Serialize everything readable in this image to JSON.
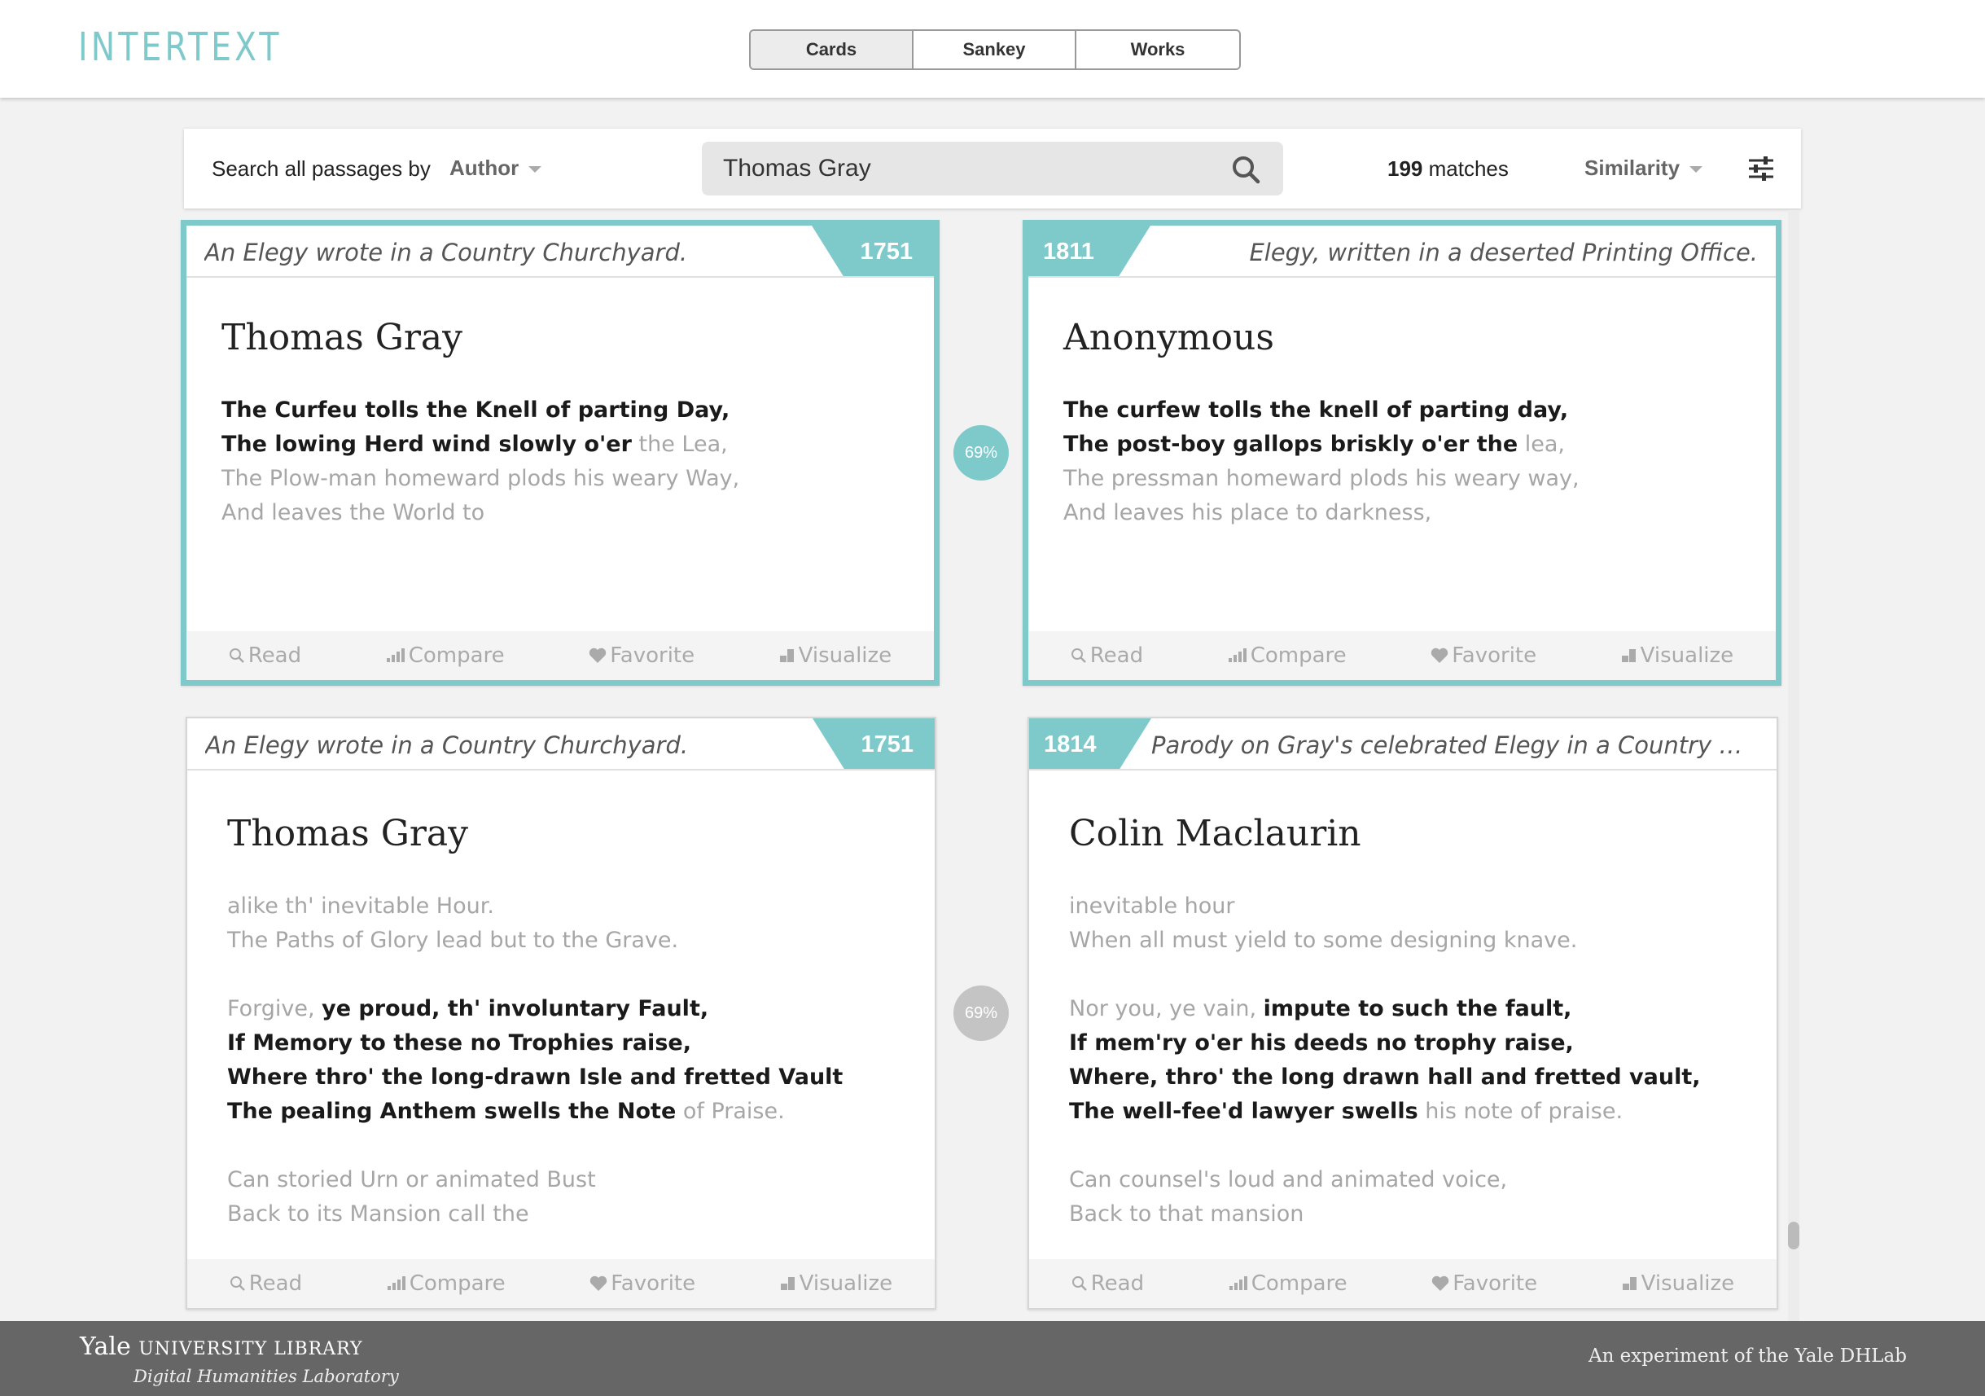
{
  "app": {
    "logo": "INTERTEXT"
  },
  "view_tabs": [
    {
      "label": "Cards",
      "active": true
    },
    {
      "label": "Sankey",
      "active": false
    },
    {
      "label": "Works",
      "active": false
    }
  ],
  "search": {
    "label": "Search all passages by",
    "field": "Author",
    "query": "Thomas Gray",
    "match_count": "199",
    "match_suffix": " matches",
    "sort": "Similarity"
  },
  "colors": {
    "accent": "#7ecacb",
    "inactive_badge": "#c4c4c4",
    "footer": "#666666"
  },
  "actions": [
    "Read",
    "Compare",
    "Favorite",
    "Visualize"
  ],
  "rows": [
    {
      "similarity": "69%",
      "selected": true,
      "left": {
        "title": "An Elegy wrote in a Country Churchyard.",
        "year": "1751",
        "author": "Thomas Gray",
        "lines": [
          [
            {
              "t": "The Curfeu tolls the Knell of parting Day,",
              "m": true
            }
          ],
          [
            {
              "t": "The lowing Herd wind slowly o'er",
              "m": true
            },
            {
              "t": " the Lea,",
              "m": false
            }
          ],
          [
            {
              "t": "The Plow-man homeward plods his weary Way,",
              "m": false
            }
          ],
          [
            {
              "t": "And leaves the World to",
              "m": false
            }
          ]
        ]
      },
      "right": {
        "title": "Elegy, written in a deserted Printing Office.",
        "year": "1811",
        "author": "Anonymous",
        "lines": [
          [
            {
              "t": "The curfew tolls the knell of parting day,",
              "m": true
            }
          ],
          [
            {
              "t": "The post-boy gallops briskly o'er the",
              "m": true
            },
            {
              "t": " lea,",
              "m": false
            }
          ],
          [
            {
              "t": "The pressman homeward plods his weary way,",
              "m": false
            }
          ],
          [
            {
              "t": "And leaves his place to darkness,",
              "m": false
            }
          ]
        ]
      }
    },
    {
      "similarity": "69%",
      "selected": false,
      "left": {
        "title": "An Elegy wrote in a Country Churchyard.",
        "year": "1751",
        "author": "Thomas Gray",
        "lines": [
          [
            {
              "t": "alike th' inevitable Hour.",
              "m": false
            }
          ],
          [
            {
              "t": "The Paths of Glory lead but to the Grave.",
              "m": false
            }
          ],
          [],
          [
            {
              "t": "Forgive, ",
              "m": false
            },
            {
              "t": "ye proud, th' involuntary Fault,",
              "m": true
            }
          ],
          [
            {
              "t": "If Memory to these no Trophies raise,",
              "m": true
            }
          ],
          [
            {
              "t": "Where thro' the long-drawn Isle and fretted Vault",
              "m": true
            }
          ],
          [
            {
              "t": "The pealing Anthem swells the Note",
              "m": true
            },
            {
              "t": " of Praise.",
              "m": false
            }
          ],
          [],
          [
            {
              "t": "Can storied Urn or animated Bust",
              "m": false
            }
          ],
          [
            {
              "t": "Back to its Mansion call the",
              "m": false
            }
          ]
        ]
      },
      "right": {
        "title": "Parody on Gray's celebrated Elegy in a Country Churc...",
        "year": "1814",
        "author": "Colin Maclaurin",
        "lines": [
          [
            {
              "t": "inevitable hour",
              "m": false
            }
          ],
          [
            {
              "t": "When all must yield to some designing knave.",
              "m": false
            }
          ],
          [],
          [
            {
              "t": "Nor you, ye vain, ",
              "m": false
            },
            {
              "t": "impute to such the fault,",
              "m": true
            }
          ],
          [
            {
              "t": "If mem'ry o'er his deeds no trophy raise,",
              "m": true
            }
          ],
          [
            {
              "t": "Where, thro' the long drawn hall and fretted vault,",
              "m": true
            }
          ],
          [
            {
              "t": "The well-fee'd lawyer swells",
              "m": true
            },
            {
              "t": " his note of praise.",
              "m": false
            }
          ],
          [],
          [
            {
              "t": "Can counsel's loud and animated voice,",
              "m": false
            }
          ],
          [
            {
              "t": "Back to that mansion",
              "m": false
            }
          ]
        ]
      }
    }
  ],
  "footer": {
    "yale": "Yale",
    "library": "UNIVERSITY LIBRARY",
    "dhl": "Digital Humanities Laboratory",
    "experiment": "An experiment of the Yale DHLab"
  }
}
